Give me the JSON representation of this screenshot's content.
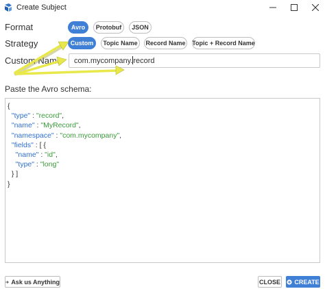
{
  "window": {
    "title": "Create Subject",
    "minimize_glyph": "—",
    "maximize_glyph": "☐",
    "close_glyph": "✕"
  },
  "format": {
    "label": "Format",
    "options": [
      "Avro",
      "Protobuf",
      "JSON"
    ],
    "selected": "Avro"
  },
  "strategy": {
    "label": "Strategy",
    "options": [
      "Custom",
      "Topic Name",
      "Record Name",
      "Topic + Record Name"
    ],
    "selected": "Custom"
  },
  "custom_name": {
    "label": "Custom Name",
    "value_before_caret": "com.mycompany.",
    "value_after_caret": "record"
  },
  "schema": {
    "label": "Paste the Avro schema:",
    "lines": [
      [
        [
          "p",
          "{"
        ]
      ],
      [
        [
          "p",
          "  "
        ],
        [
          "k",
          "\"type\""
        ],
        [
          "p",
          " : "
        ],
        [
          "s",
          "\"record\""
        ],
        [
          "p",
          ","
        ]
      ],
      [
        [
          "p",
          "  "
        ],
        [
          "k",
          "\"name\""
        ],
        [
          "p",
          " : "
        ],
        [
          "s",
          "\"MyRecord\""
        ],
        [
          "p",
          ","
        ]
      ],
      [
        [
          "p",
          "  "
        ],
        [
          "k",
          "\"namespace\""
        ],
        [
          "p",
          " : "
        ],
        [
          "s",
          "\"com.mycompany\""
        ],
        [
          "p",
          ","
        ]
      ],
      [
        [
          "p",
          "  "
        ],
        [
          "k",
          "\"fields\""
        ],
        [
          "p",
          " : [ {"
        ]
      ],
      [
        [
          "p",
          "    "
        ],
        [
          "k",
          "\"name\""
        ],
        [
          "p",
          " : "
        ],
        [
          "s",
          "\"id\""
        ],
        [
          "p",
          ","
        ]
      ],
      [
        [
          "p",
          "    "
        ],
        [
          "k",
          "\"type\""
        ],
        [
          "p",
          " : "
        ],
        [
          "s",
          "\"long\""
        ]
      ],
      [
        [
          "p",
          "  } ]"
        ]
      ],
      [
        [
          "p",
          "}"
        ]
      ]
    ]
  },
  "footer": {
    "ask_label": "Ask us Anything",
    "close_label": "CLOSE",
    "create_label": "CREATE"
  },
  "colors": {
    "accent": "#3f7fd6",
    "annotation_arrow": "#e8e84a",
    "json_key": "#2e6fd0",
    "json_string": "#3a9a3a"
  },
  "icons": {
    "app": "app-logo-icon",
    "ask": "arrow-right-icon",
    "create": "plus-circle-icon"
  }
}
